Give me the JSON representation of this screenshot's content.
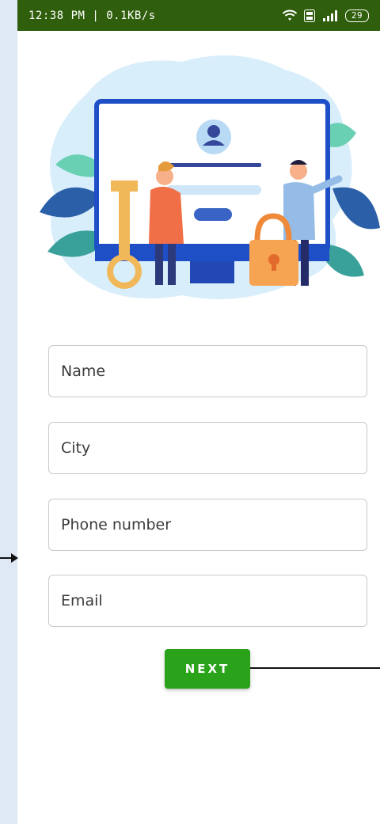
{
  "status_bar": {
    "time_speed": "12:38 PM | 0.1KB/s",
    "battery": "29"
  },
  "form": {
    "name_placeholder": "Name",
    "city_placeholder": "City",
    "phone_placeholder": "Phone number",
    "email_placeholder": "Email"
  },
  "next_button": {
    "label": "NEXT"
  },
  "colors": {
    "status_bar": "#2f5e0c",
    "button": "#2aa21a",
    "left_strip": "#dfe9f6"
  },
  "icons": [
    "wifi-icon",
    "volte-icon",
    "signal-icon",
    "battery-icon"
  ]
}
